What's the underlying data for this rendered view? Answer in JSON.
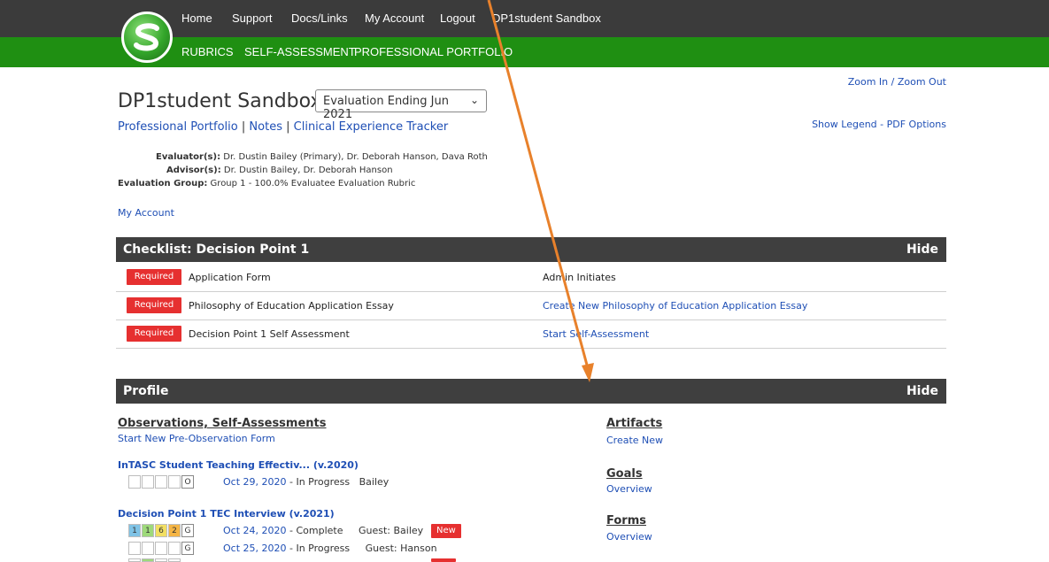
{
  "nav": {
    "top": [
      "Home",
      "Support",
      "Docs/Links",
      "My Account",
      "Logout",
      "DP1student Sandbox"
    ],
    "green": [
      "RUBRICS",
      "SELF-ASSESSMENT",
      "PROFESSIONAL PORTFOLIO"
    ]
  },
  "header": {
    "zoom": "Zoom In / Zoom Out",
    "legend": "Show Legend - PDF Options",
    "student_name": "DP1student Sandbox",
    "evaluation_select": "Evaluation Ending Jun 2021",
    "subnav": {
      "portfolio": "Professional Portfolio",
      "sep": "|",
      "notes": "Notes",
      "tracker": "Clinical Experience Tracker"
    },
    "info": {
      "evaluators_label": "Evaluator(s):",
      "evaluators": "Dr. Dustin Bailey (Primary), Dr. Deborah Hanson, Dava Roth",
      "advisors_label": "Advisor(s):",
      "advisors": "Dr. Dustin Bailey, Dr. Deborah Hanson",
      "group_label": "Evaluation Group:",
      "group": "Group 1 - 100.0% Evaluatee Evaluation Rubric"
    },
    "my_account": "My Account"
  },
  "checklist": {
    "title": "Checklist: Decision Point 1",
    "hide": "Hide",
    "rows": [
      {
        "badge": "Required",
        "label": "Application Form",
        "action": "Admin Initiates",
        "action_link": false
      },
      {
        "badge": "Required",
        "label": "Philosophy of Education Application Essay",
        "action": "Create New Philosophy of Education Application Essay",
        "action_link": true
      },
      {
        "badge": "Required",
        "label": "Decision Point 1 Self Assessment",
        "action": "Start Self-Assessment",
        "action_link": true
      }
    ]
  },
  "profile": {
    "title": "Profile",
    "hide": "Hide",
    "obs_heading": "Observations, Self-Assessments",
    "start_new": "Start New Pre-Observation Form",
    "items": [
      {
        "title": "InTASC Student Teaching Effectiv... (v.2020)",
        "entries": [
          {
            "boxes": [
              "",
              "",
              "",
              "",
              "O"
            ],
            "date": "Oct 29, 2020",
            "status": "- In Progress",
            "who": "Bailey",
            "new": ""
          }
        ]
      },
      {
        "title": "Decision Point 1 TEC Interview (v.2021)",
        "entries": [
          {
            "boxes": [
              "1",
              "1",
              "6",
              "2",
              "G"
            ],
            "date": "Oct 24, 2020",
            "status": "- Complete",
            "who": "Guest: Bailey",
            "new": "New"
          },
          {
            "boxes": [
              "",
              "",
              "",
              "",
              "G"
            ],
            "date": "Oct 25, 2020",
            "status": "- In Progress",
            "who": "Guest: Hanson",
            "new": ""
          }
        ]
      }
    ],
    "artifacts": {
      "heading": "Artifacts",
      "link": "Create New"
    },
    "goals": {
      "heading": "Goals",
      "link": "Overview"
    },
    "forms": {
      "heading": "Forms",
      "link": "Overview"
    }
  },
  "colors": {
    "topbar": "#3b3b3b",
    "greenbar": "#1f8f12",
    "section_head": "#3f3f3f",
    "required": "#e63030",
    "link": "#1f4fb5",
    "arrow": "#e8812b"
  },
  "icons": {
    "logo": "s-logo-icon",
    "select": "chevron-down-icon",
    "annotation": "arrow-annotation"
  }
}
